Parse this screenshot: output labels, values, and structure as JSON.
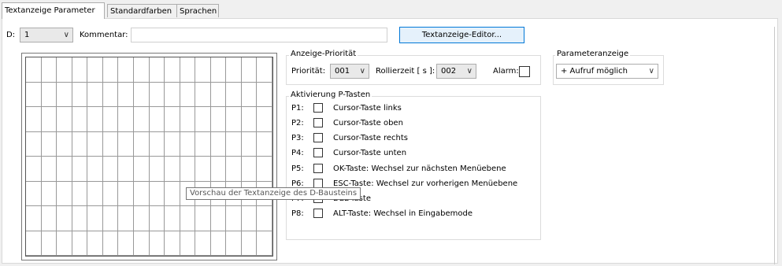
{
  "tabs": [
    {
      "label": "Textanzeige Parameter",
      "active": true
    },
    {
      "label": "Standardfarben",
      "active": false
    },
    {
      "label": "Sprachen",
      "active": false
    }
  ],
  "header": {
    "d_label": "D:",
    "d_value": "1",
    "comment_label": "Kommentar:",
    "comment_value": "",
    "editor_button": "Textanzeige-Editor..."
  },
  "priority_group": {
    "title": "Anzeige-Priorität",
    "priority_label": "Priorität:",
    "priority_value": "001",
    "scroll_label": "Rollierzeit [ s ]:",
    "scroll_value": "002",
    "alarm_label": "Alarm:",
    "alarm_checked": false
  },
  "param_group": {
    "title": "Parameteranzeige",
    "value": "+ Aufruf möglich"
  },
  "ptasten_group": {
    "title": "Aktivierung P-Tasten",
    "items": [
      {
        "key": "P1:",
        "desc": "Cursor-Taste links",
        "checked": false
      },
      {
        "key": "P2:",
        "desc": "Cursor-Taste oben",
        "checked": false
      },
      {
        "key": "P3:",
        "desc": "Cursor-Taste rechts",
        "checked": false
      },
      {
        "key": "P4:",
        "desc": "Cursor-Taste unten",
        "checked": false
      },
      {
        "key": "P5:",
        "desc": "OK-Taste: Wechsel zur nächsten Menüebene",
        "checked": false
      },
      {
        "key": "P6:",
        "desc": "ESC-Taste: Wechsel zur vorherigen Menüebene",
        "checked": false
      },
      {
        "key": "P7:",
        "desc": "DEL-Taste",
        "checked": false
      },
      {
        "key": "P8:",
        "desc": "ALT-Taste: Wechsel in Eingabemode",
        "checked": false
      }
    ]
  },
  "preview": {
    "tooltip": "Vorschau der Textanzeige des D-Bausteins"
  }
}
